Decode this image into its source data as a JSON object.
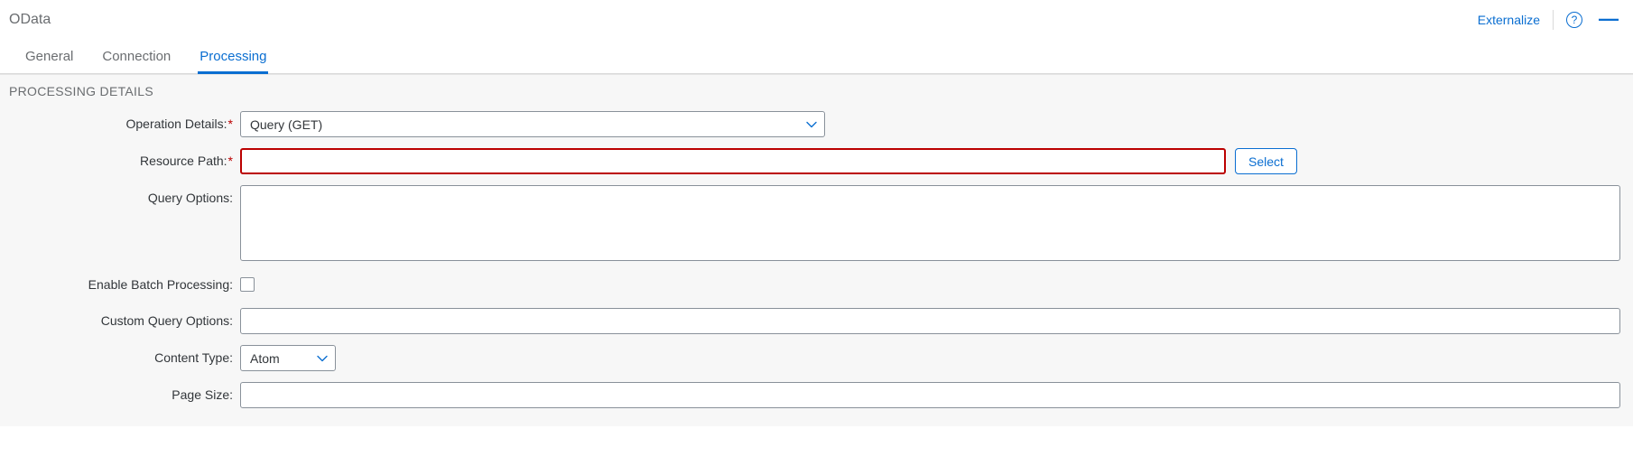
{
  "header": {
    "title": "OData",
    "externalize": "Externalize",
    "help_glyph": "?",
    "minimize_glyph": "—"
  },
  "tabs": [
    {
      "label": "General",
      "active": false
    },
    {
      "label": "Connection",
      "active": false
    },
    {
      "label": "Processing",
      "active": true
    }
  ],
  "section": {
    "title": "PROCESSING DETAILS"
  },
  "form": {
    "operation_details": {
      "label": "Operation Details:",
      "value": "Query (GET)"
    },
    "resource_path": {
      "label": "Resource Path:",
      "value": "",
      "select_button": "Select"
    },
    "query_options": {
      "label": "Query Options:",
      "value": ""
    },
    "enable_batch": {
      "label": "Enable Batch Processing:",
      "checked": false
    },
    "custom_query": {
      "label": "Custom Query Options:",
      "value": ""
    },
    "content_type": {
      "label": "Content Type:",
      "value": "Atom"
    },
    "page_size": {
      "label": "Page Size:",
      "value": ""
    }
  }
}
